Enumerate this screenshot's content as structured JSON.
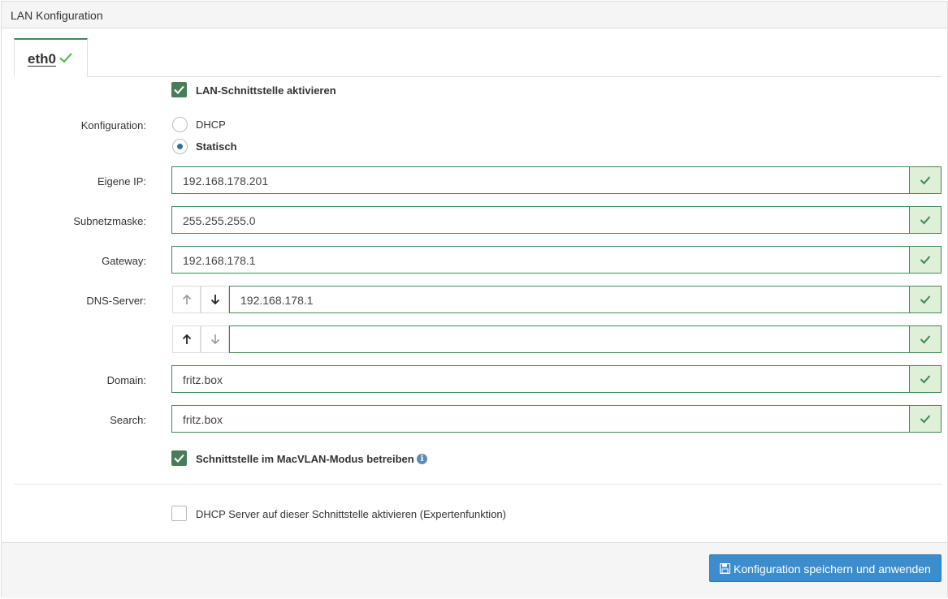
{
  "panel": {
    "title": "LAN Konfiguration"
  },
  "tab": {
    "label": "eth0"
  },
  "enable_lan": {
    "label": "LAN-Schnittstelle aktivieren",
    "checked": true
  },
  "config": {
    "label": "Konfiguration:",
    "options": [
      {
        "label": "DHCP",
        "selected": false
      },
      {
        "label": "Statisch",
        "selected": true
      }
    ]
  },
  "fields": {
    "ip": {
      "label": "Eigene IP:",
      "value": "192.168.178.201"
    },
    "subnet": {
      "label": "Subnetzmaske:",
      "value": "255.255.255.0"
    },
    "gateway": {
      "label": "Gateway:",
      "value": "192.168.178.1"
    },
    "dns": {
      "label": "DNS-Server:",
      "values": [
        "192.168.178.1",
        ""
      ]
    },
    "domain": {
      "label": "Domain:",
      "value": "fritz.box"
    },
    "search": {
      "label": "Search:",
      "value": "fritz.box"
    }
  },
  "macvlan": {
    "label": "Schnittstelle im MacVLAN-Modus betreiben",
    "checked": true,
    "info_icon": "i"
  },
  "dhcp_server": {
    "label": "DHCP Server auf dieser Schnittstelle aktivieren (Expertenfunktion)",
    "checked": false
  },
  "footer": {
    "save_label": "Konfiguration speichern und anwenden"
  },
  "colors": {
    "accent_green": "#3d8a56",
    "valid_bg": "#dff0d8",
    "primary_blue": "#3c8dce"
  }
}
